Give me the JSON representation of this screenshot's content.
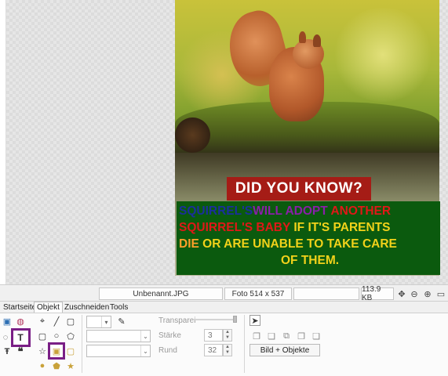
{
  "image": {
    "title": "DID YOU KNOW?",
    "line1": {
      "a": "SQUIRREL'S",
      "b": "WILL ADOPT",
      "c": "ANOTHER"
    },
    "line2": {
      "a": "SQUIRREL'S BABY",
      "b": "IF IT'S PARENTS"
    },
    "line3": {
      "a": "DIE",
      "b": "OR ARE UNABLE TO TAKE CARE"
    },
    "line4": "OF THEM."
  },
  "status": {
    "filename": "Unbenannt.JPG",
    "photo_size": "Foto 514 x 537",
    "file_size": "113.9 KB"
  },
  "tabs": [
    {
      "label": "Startseite"
    },
    {
      "label": "Objekt"
    },
    {
      "label": "Zuschneiden"
    },
    {
      "label": "Tools"
    }
  ],
  "props": {
    "transparency_label": "Transparei",
    "strength_label": "Stärke",
    "strength_value": "3",
    "round_label": "Rund",
    "round_value": "32",
    "apply_button": "Bild + Objekte"
  },
  "icons": {
    "text_tool": "T",
    "quote_tool": "❝",
    "text_tool_small": "Ŧ",
    "brush_tool": "✎",
    "star_tool": "☆"
  },
  "colors": {
    "highlight": "#7a1f86",
    "title_bg": "#a51c16",
    "text_bg": "#0b5a0e"
  }
}
